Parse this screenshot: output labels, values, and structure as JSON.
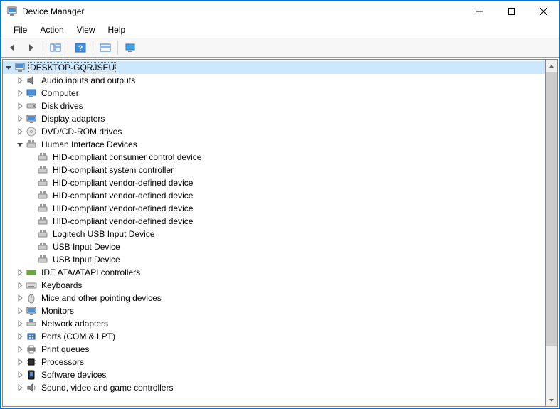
{
  "window": {
    "title": "Device Manager"
  },
  "menu": {
    "file": "File",
    "action": "Action",
    "view": "View",
    "help": "Help"
  },
  "tree": {
    "root": "DESKTOP-GQRJSEU",
    "categories": [
      {
        "label": "Audio inputs and outputs",
        "icon": "audio",
        "expandable": true,
        "expanded": false
      },
      {
        "label": "Computer",
        "icon": "computer",
        "expandable": true,
        "expanded": false
      },
      {
        "label": "Disk drives",
        "icon": "disk",
        "expandable": true,
        "expanded": false
      },
      {
        "label": "Display adapters",
        "icon": "display",
        "expandable": true,
        "expanded": false
      },
      {
        "label": "DVD/CD-ROM drives",
        "icon": "dvd",
        "expandable": true,
        "expanded": false
      },
      {
        "label": "Human Interface Devices",
        "icon": "hid",
        "expandable": true,
        "expanded": true,
        "children": [
          {
            "label": "HID-compliant consumer control device"
          },
          {
            "label": "HID-compliant system controller"
          },
          {
            "label": "HID-compliant vendor-defined device"
          },
          {
            "label": "HID-compliant vendor-defined device"
          },
          {
            "label": "HID-compliant vendor-defined device"
          },
          {
            "label": "HID-compliant vendor-defined device"
          },
          {
            "label": "Logitech USB Input Device"
          },
          {
            "label": "USB Input Device"
          },
          {
            "label": "USB Input Device"
          }
        ]
      },
      {
        "label": "IDE ATA/ATAPI controllers",
        "icon": "ide",
        "expandable": true,
        "expanded": false
      },
      {
        "label": "Keyboards",
        "icon": "keyboard",
        "expandable": true,
        "expanded": false
      },
      {
        "label": "Mice and other pointing devices",
        "icon": "mouse",
        "expandable": true,
        "expanded": false
      },
      {
        "label": "Monitors",
        "icon": "monitor",
        "expandable": true,
        "expanded": false
      },
      {
        "label": "Network adapters",
        "icon": "network",
        "expandable": true,
        "expanded": false
      },
      {
        "label": "Ports (COM & LPT)",
        "icon": "ports",
        "expandable": true,
        "expanded": false
      },
      {
        "label": "Print queues",
        "icon": "print",
        "expandable": true,
        "expanded": false
      },
      {
        "label": "Processors",
        "icon": "cpu",
        "expandable": true,
        "expanded": false
      },
      {
        "label": "Software devices",
        "icon": "software",
        "expandable": true,
        "expanded": false
      },
      {
        "label": "Sound, video and game controllers",
        "icon": "sound",
        "expandable": true,
        "expanded": false
      }
    ]
  }
}
